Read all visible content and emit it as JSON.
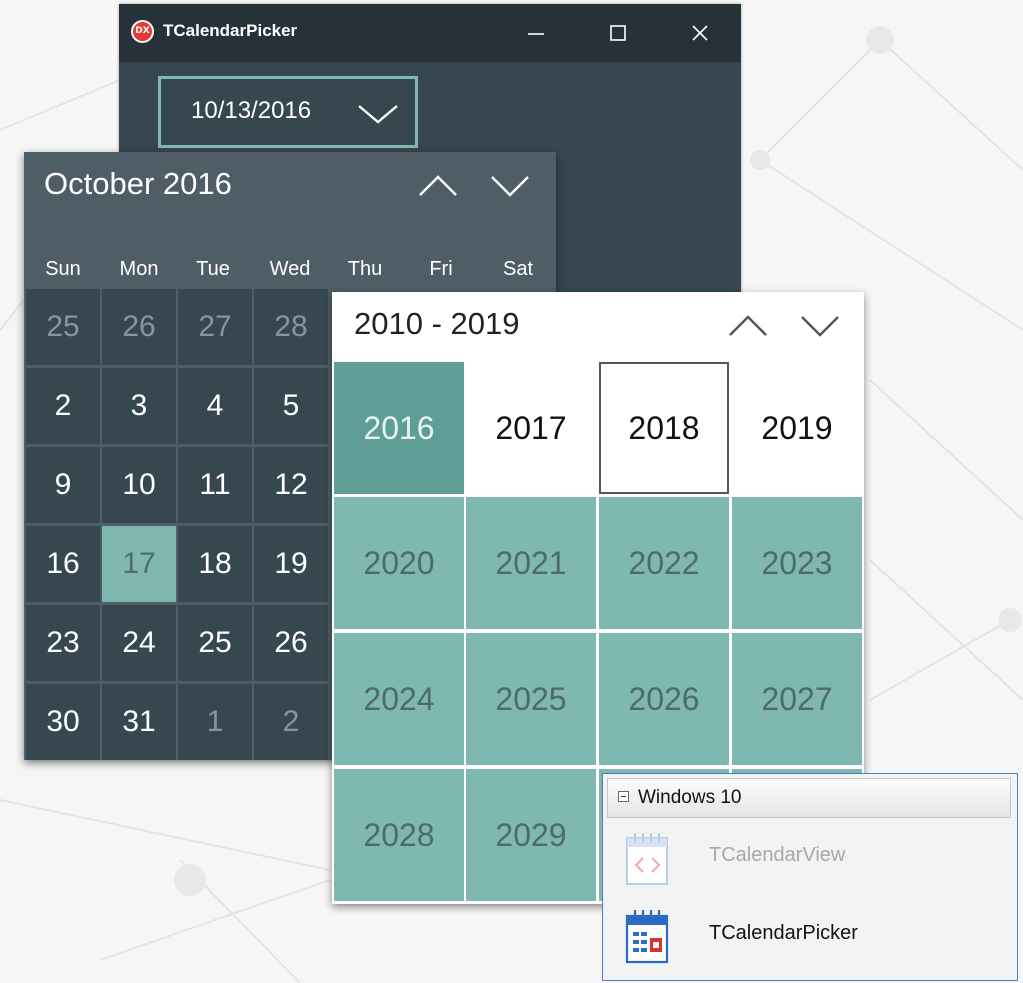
{
  "window": {
    "title": "TCalendarPicker",
    "app_icon_text": "DX",
    "date_value": "10/13/2016"
  },
  "month_calendar": {
    "title": "October 2016",
    "weekdays": [
      "Sun",
      "Mon",
      "Tue",
      "Wed",
      "Thu",
      "Fri",
      "Sat"
    ],
    "rows": [
      [
        "25",
        "26",
        "27",
        "28"
      ],
      [
        "2",
        "3",
        "4",
        "5"
      ],
      [
        "9",
        "10",
        "11",
        "12"
      ],
      [
        "16",
        "17",
        "18",
        "19"
      ],
      [
        "23",
        "24",
        "25",
        "26"
      ],
      [
        "30",
        "31",
        "1",
        "2"
      ]
    ],
    "selected_day": "17"
  },
  "decade_view": {
    "title": "2010 - 2019",
    "years": [
      [
        "2016",
        "2017",
        "2018",
        "2019"
      ],
      [
        "2020",
        "2021",
        "2022",
        "2023"
      ],
      [
        "2024",
        "2025",
        "2026",
        "2027"
      ],
      [
        "2028",
        "2029"
      ]
    ],
    "current_year": "2016",
    "focused_year": "2018"
  },
  "palette": {
    "category": "Windows 10",
    "items": [
      {
        "name": "TCalendarView",
        "enabled": false
      },
      {
        "name": "TCalendarPicker",
        "enabled": true
      }
    ]
  },
  "colors": {
    "window_bg": "#37474f",
    "titlebar_bg": "#263238",
    "accent": "#80b7b0",
    "current_year": "#5e9e97"
  }
}
